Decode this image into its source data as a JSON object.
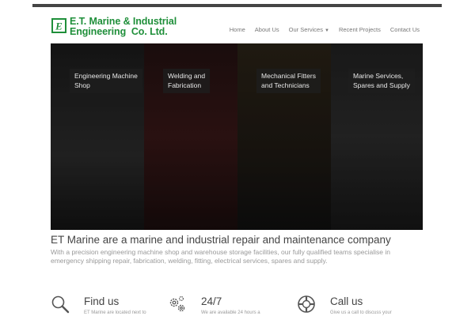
{
  "brand": {
    "mark": "E",
    "line1": "E.T. Marine & Industrial",
    "line2": "Engineering  Co. Ltd."
  },
  "nav": [
    {
      "label": "Home"
    },
    {
      "label": "About Us"
    },
    {
      "label": "Our Services"
    },
    {
      "label": "Recent Projects"
    },
    {
      "label": "Contact Us"
    }
  ],
  "hero": {
    "panels": [
      {
        "line1": "Engineering Machine",
        "line2": "Shop"
      },
      {
        "line1": "Welding and",
        "line2": "Fabrication"
      },
      {
        "line1": "Mechanical Fitters",
        "line2": "and Technicians"
      },
      {
        "line1": "Marine Services,",
        "line2": "Spares and Supply"
      }
    ]
  },
  "main": {
    "headline": "ET Marine are a marine and industrial repair and maintenance company",
    "intro": "With a precision engineering machine shop and warehouse storage facilities, our fully qualified teams specialise in emergency shipping repair, fabrication, welding, fitting, electrical services, spares and supply."
  },
  "features": [
    {
      "title": "Find us",
      "text": "ET Marine are located next to",
      "icon": "search-icon"
    },
    {
      "title": "24/7",
      "text": "We are available 24 hours a",
      "icon": "gears-icon"
    },
    {
      "title": "Call us",
      "text": "Give us a call to discuss your",
      "icon": "lifebuoy-icon"
    }
  ],
  "colors": {
    "brand_green": "#1f8f3a",
    "nav_text": "#777777",
    "headline": "#444444",
    "body_text": "#999999"
  }
}
